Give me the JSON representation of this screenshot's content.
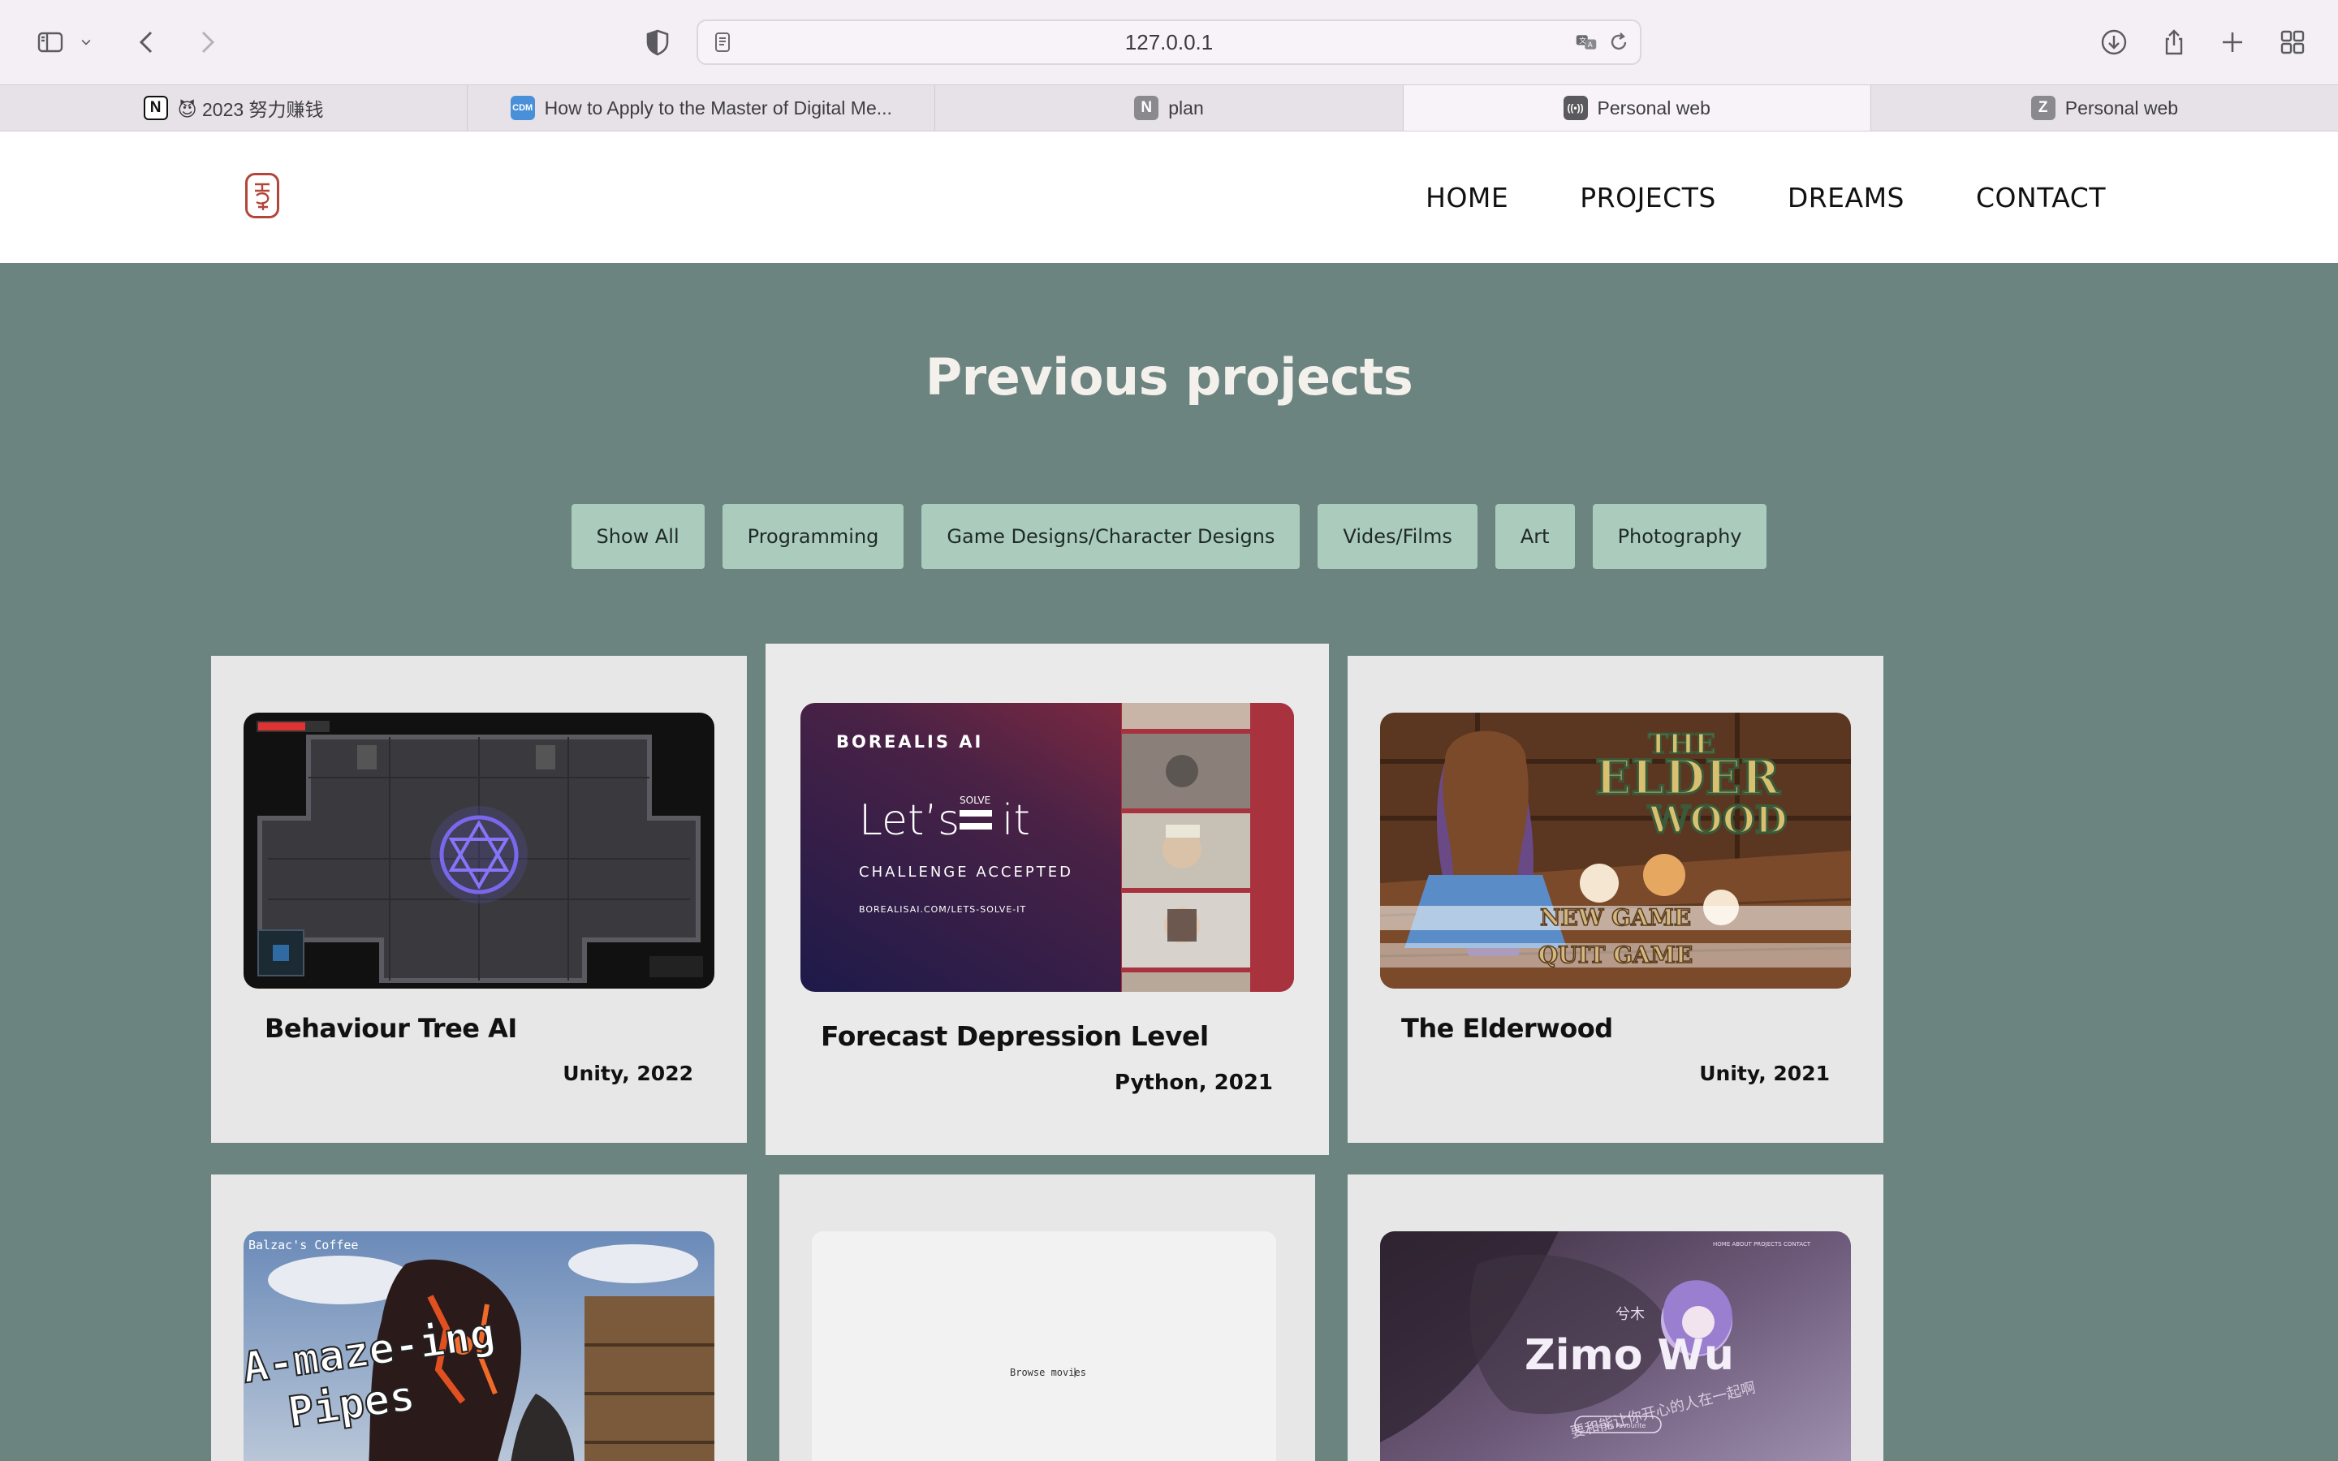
{
  "browser": {
    "url": "127.0.0.1",
    "tabs": [
      {
        "label": "😈 2023 努力赚钱",
        "favicon": "N",
        "favicon_name": "notion-icon"
      },
      {
        "label": "How to Apply to the Master of Digital Me...",
        "favicon": "CDM",
        "favicon_name": "cdm-icon"
      },
      {
        "label": "plan",
        "favicon": "N",
        "favicon_name": "notion-icon"
      },
      {
        "label": "Personal web",
        "favicon": "((•))",
        "favicon_name": "live-server-icon",
        "active": true
      },
      {
        "label": "Personal web",
        "favicon": "Z",
        "favicon_name": "z-site-icon"
      }
    ]
  },
  "site": {
    "nav": {
      "home": "HOME",
      "projects": "PROJECTS",
      "dreams": "DREAMS",
      "contact": "CONTACT"
    },
    "section_title": "Previous projects",
    "filters": [
      "Show All",
      "Programming",
      "Game Designs/Character Designs",
      "Vides/Films",
      "Art",
      "Photography"
    ],
    "projects": [
      {
        "title": "Behaviour Tree AI",
        "meta": "Unity, 2022"
      },
      {
        "title": "Forecast Depression Level",
        "meta": "Python, 2021"
      },
      {
        "title": "The Elderwood",
        "meta": "Unity, 2021"
      },
      {
        "title": "",
        "meta": ""
      },
      {
        "title": "",
        "meta": ""
      },
      {
        "title": "",
        "meta": ""
      }
    ],
    "thumb_text": {
      "borealis_brand": "BOREALIS AI",
      "borealis_lets": "Let’s",
      "borealis_solve": "SOLVE",
      "borealis_it": "it",
      "borealis_challenge": "CHALLENGE ACCEPTED",
      "borealis_url": "BOREALISAI.COM/LETS-SOLVE-IT",
      "elderwood_the": "THE",
      "elderwood_elder": "ELDER",
      "elderwood_wood": "WOOD",
      "elderwood_new": "NEW GAME",
      "elderwood_quit": "QUIT GAME",
      "pipes_line1": "A-maze-ing",
      "pipes_line2": "Pipes",
      "pipes_corner": "Balzac's Coffee",
      "movies_text": "Browse movies",
      "zimo_name": "Zimo Wu",
      "zimo_cn": "兮木",
      "zimo_tagline": "要和能让你开心的人在一起啊",
      "zimo_btn": "See My Favourite",
      "zimo_nav": "HOME  ABOUT  PROJECTS  CONTACT"
    }
  },
  "colors": {
    "page_bg": "#6b8480",
    "filter_bg": "#abcbbd",
    "card_bg": "#e6e7e6",
    "title_color": "#f4f1ec",
    "logo_red": "#b2463a"
  }
}
